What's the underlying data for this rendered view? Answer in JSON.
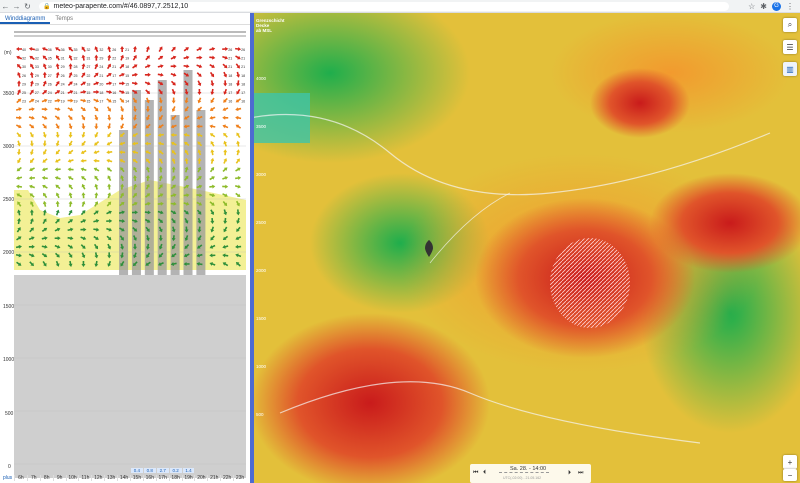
{
  "browser": {
    "url": "meteo-parapente.com/#/46.0897,7.2512,10",
    "avatar": "G"
  },
  "tabs": [
    {
      "label": "Winddiagramm",
      "active": true
    },
    {
      "label": "Temps",
      "active": false
    }
  ],
  "altitude_axis": {
    "unit": "(m)",
    "labels": [
      "3500",
      "3000",
      "2500",
      "2000",
      "1500",
      "1000",
      "500",
      "0"
    ]
  },
  "hours": [
    "6h",
    "7h",
    "8h",
    "9h",
    "10h",
    "11h",
    "12h",
    "13h",
    "14h",
    "15h",
    "16h",
    "17h",
    "18h",
    "19h",
    "20h",
    "21h",
    "22h",
    "23h"
  ],
  "precip": [
    "",
    "",
    "",
    "",
    "",
    "",
    "",
    "",
    "",
    "0.4",
    "0.8",
    "2.7",
    "0.2",
    "1.4",
    "",
    "",
    "",
    ""
  ],
  "plus_label": "plus",
  "wind_rows": [
    [
      "40",
      "40",
      "36",
      "36",
      "35",
      "32",
      "32",
      "26",
      "21",
      "",
      "",
      "",
      "",
      "",
      "",
      "",
      "26",
      "26"
    ],
    [
      "32",
      "32",
      "35",
      "31",
      "32",
      "31",
      "29",
      "22",
      "19",
      "",
      "",
      "",
      "",
      "",
      "",
      "",
      "21",
      "21"
    ],
    [
      "30",
      "33",
      "30",
      "29",
      "28",
      "27",
      "24",
      "21",
      "18",
      "",
      "",
      "",
      "",
      "",
      "",
      "",
      "21",
      "21"
    ],
    [
      "26",
      "29",
      "27",
      "26",
      "25",
      "22",
      "21",
      "17",
      "15",
      "",
      "",
      "",
      "",
      "",
      "",
      "",
      "18",
      "18"
    ],
    [
      "29",
      "29",
      "26",
      "24",
      "24",
      "18",
      "20",
      "17",
      "15",
      "",
      "",
      "",
      "",
      "",
      "",
      "",
      "18",
      "18"
    ],
    [
      "25",
      "27",
      "24",
      "21",
      "21",
      "15",
      "18",
      "16",
      "15",
      "",
      "",
      "",
      "",
      "",
      "",
      "",
      "17",
      "17"
    ],
    [
      "23",
      "24",
      "22",
      "19",
      "19",
      "15",
      "17",
      "15",
      "14",
      "",
      "",
      "",
      "",
      "",
      "",
      "",
      "16",
      "16"
    ]
  ],
  "map": {
    "legend_title_1": "Grenzschicht",
    "legend_title_2": "Decke",
    "legend_title_3": "ab MSL",
    "legend_labels": [
      "4000",
      "3500",
      "3000",
      "2500",
      "2000",
      "1500",
      "1000",
      "500"
    ],
    "time_label": "Sa. 28. - 14:00",
    "time_sub": "UTC(-02:00) - 21.05.162",
    "colors": {
      "accent": "#1a5fb4",
      "high": "#d7261e",
      "mid": "#f0c419",
      "low": "#2db24a"
    }
  }
}
